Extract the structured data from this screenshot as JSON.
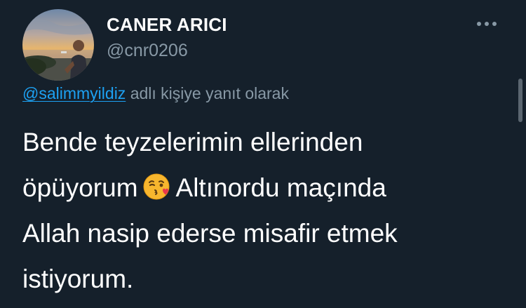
{
  "tweet": {
    "display_name": "CANER ARICI",
    "handle": "@cnr0206",
    "reply_mention": "@salimmyildiz",
    "reply_suffix": "adlı kişiye yanıt olarak",
    "body_line1": "Bende teyzelerimin ellerinden",
    "body_line2_before": "öpüyorum",
    "body_line2_emoji": "face-blowing-kiss-emoji",
    "body_line2_after": "Altınordu maçında",
    "body_line3": "Allah nasip ederse misafir etmek",
    "body_line4": "istiyorum."
  },
  "icons": {
    "more": "more-horizontal-icon"
  },
  "colors": {
    "background": "#15202b",
    "text": "#ffffff",
    "secondary_text": "#8899a6",
    "link": "#1da1f2"
  }
}
